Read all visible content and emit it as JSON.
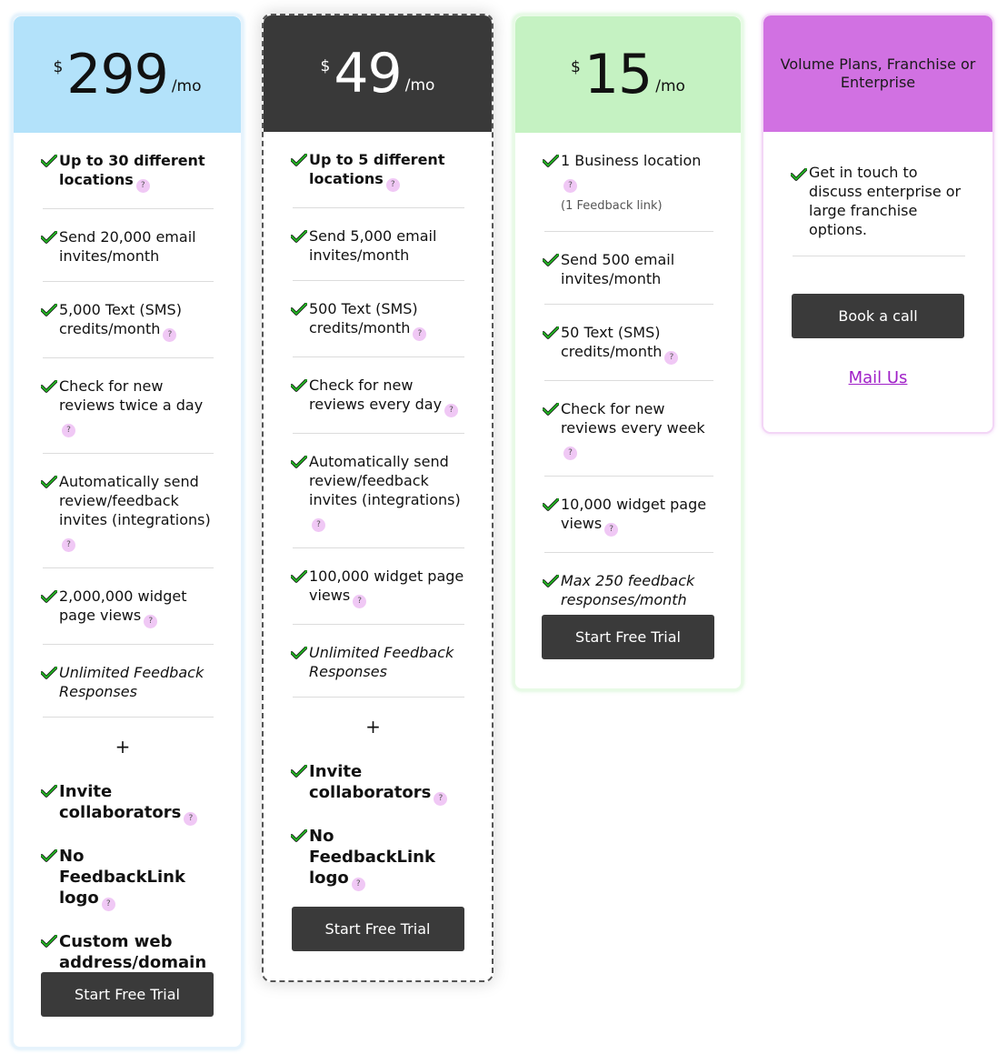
{
  "colors": {
    "header_299": "#b3e2fa",
    "header_49": "#393939",
    "header_15": "#c5f2c2",
    "header_enterprise": "#d171e2",
    "button": "#3a3a3a",
    "check": "#22b222",
    "help_badge": "#f0c8f5",
    "mail_link": "#a020c8"
  },
  "plans": [
    {
      "id": "plan-299",
      "currency": "$",
      "amount": "299",
      "period": "/mo",
      "features": [
        {
          "text": "Up to 30 different locations",
          "help": true,
          "style": "bold"
        },
        {
          "text": "Send 20,000 email invites/month",
          "help": false,
          "style": "normal"
        },
        {
          "text": "5,000 Text (SMS) credits/month",
          "help": true,
          "style": "normal"
        },
        {
          "text": "Check for new reviews twice a day",
          "help": true,
          "style": "normal"
        },
        {
          "text": "Automatically send review/feedback invites (integrations)",
          "help": true,
          "style": "normal"
        },
        {
          "text": "2,000,000 widget page views",
          "help": true,
          "style": "normal"
        },
        {
          "text": "Unlimited Feedback Responses",
          "help": false,
          "style": "italic"
        }
      ],
      "plus": "+",
      "extras": [
        {
          "text": "Invite collaborators",
          "help": true
        },
        {
          "text": "No FeedbackLink logo",
          "help": true
        },
        {
          "text": "Custom web address/domain",
          "help": true
        }
      ],
      "button": "Start Free Trial"
    },
    {
      "id": "plan-49",
      "currency": "$",
      "amount": "49",
      "period": "/mo",
      "features": [
        {
          "text": "Up to 5 different locations",
          "help": true,
          "style": "bold"
        },
        {
          "text": "Send 5,000 email invites/month",
          "help": false,
          "style": "normal"
        },
        {
          "text": "500 Text (SMS) credits/month",
          "help": true,
          "style": "normal"
        },
        {
          "text": "Check for new reviews every day",
          "help": true,
          "style": "normal"
        },
        {
          "text": "Automatically send review/feedback invites (integrations)",
          "help": true,
          "style": "normal"
        },
        {
          "text": "100,000 widget page views",
          "help": true,
          "style": "normal"
        },
        {
          "text": "Unlimited Feedback Responses",
          "help": false,
          "style": "italic"
        }
      ],
      "plus": "+",
      "extras": [
        {
          "text": "Invite collaborators",
          "help": true
        },
        {
          "text": "No FeedbackLink logo",
          "help": true
        }
      ],
      "button": "Start Free Trial"
    },
    {
      "id": "plan-15",
      "currency": "$",
      "amount": "15",
      "period": "/mo",
      "features": [
        {
          "text": "1 Business location",
          "sub": "(1 Feedback link)",
          "help": true,
          "style": "normal"
        },
        {
          "text": "Send 500 email invites/month",
          "help": false,
          "style": "normal"
        },
        {
          "text": "50 Text (SMS) credits/month",
          "help": true,
          "style": "normal"
        },
        {
          "text": "Check for new reviews every week",
          "help": true,
          "style": "normal"
        },
        {
          "text": "10,000 widget page views",
          "help": true,
          "style": "normal"
        },
        {
          "text": "Max 250 feedback responses/month",
          "help": false,
          "style": "italic"
        }
      ],
      "button": "Start Free Trial"
    }
  ],
  "enterprise": {
    "title": "Volume Plans, Franchise or Enterprise",
    "feature": "Get in touch to discuss enterprise or large franchise options.",
    "button": "Book a call",
    "link": "Mail Us"
  },
  "help_symbol": "?"
}
